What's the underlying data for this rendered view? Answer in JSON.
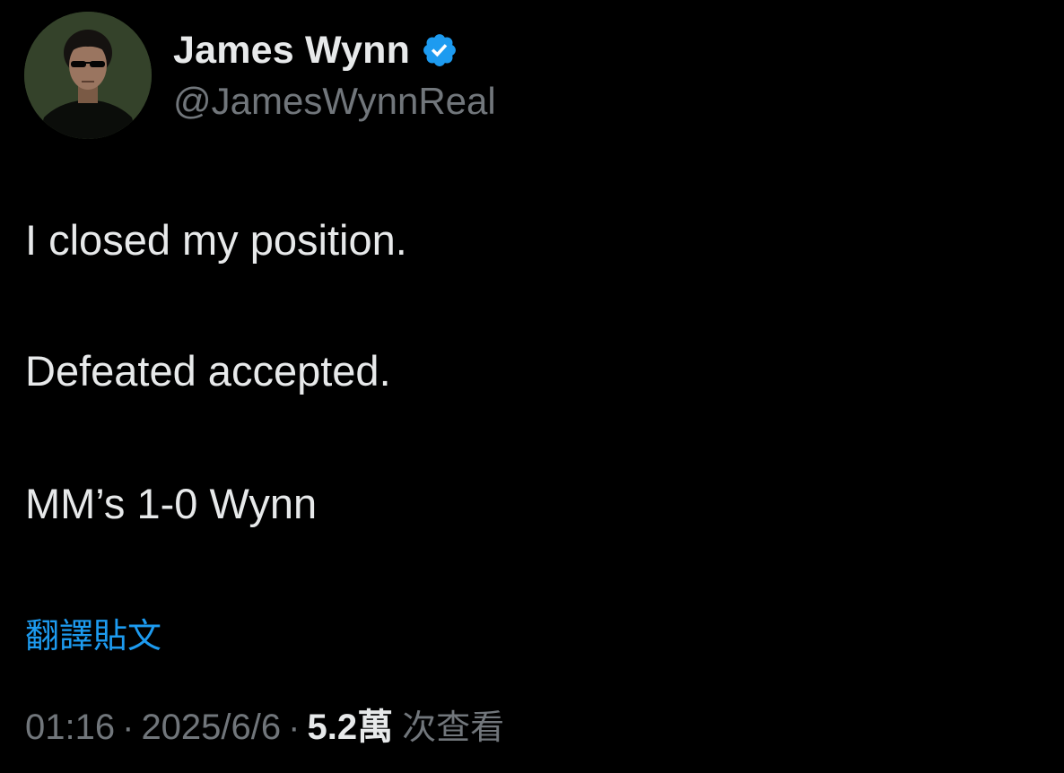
{
  "author": {
    "display_name": "James Wynn",
    "handle": "@JamesWynnReal",
    "verified": true,
    "avatar_icon": "profile-photo"
  },
  "post": {
    "lines": [
      "I closed my position.",
      "Defeated accepted.",
      "MM’s 1-0 Wynn"
    ],
    "translate_link": "翻譯貼文"
  },
  "meta": {
    "time": "01:16",
    "date": "2025/6/6",
    "separator": "·",
    "views_count": "5.2萬",
    "views_label": "次查看"
  },
  "colors": {
    "background": "#000000",
    "text_primary": "#e7e9ea",
    "text_secondary": "#71767b",
    "link": "#1d9bf0",
    "verified_badge": "#1d9bf0"
  }
}
